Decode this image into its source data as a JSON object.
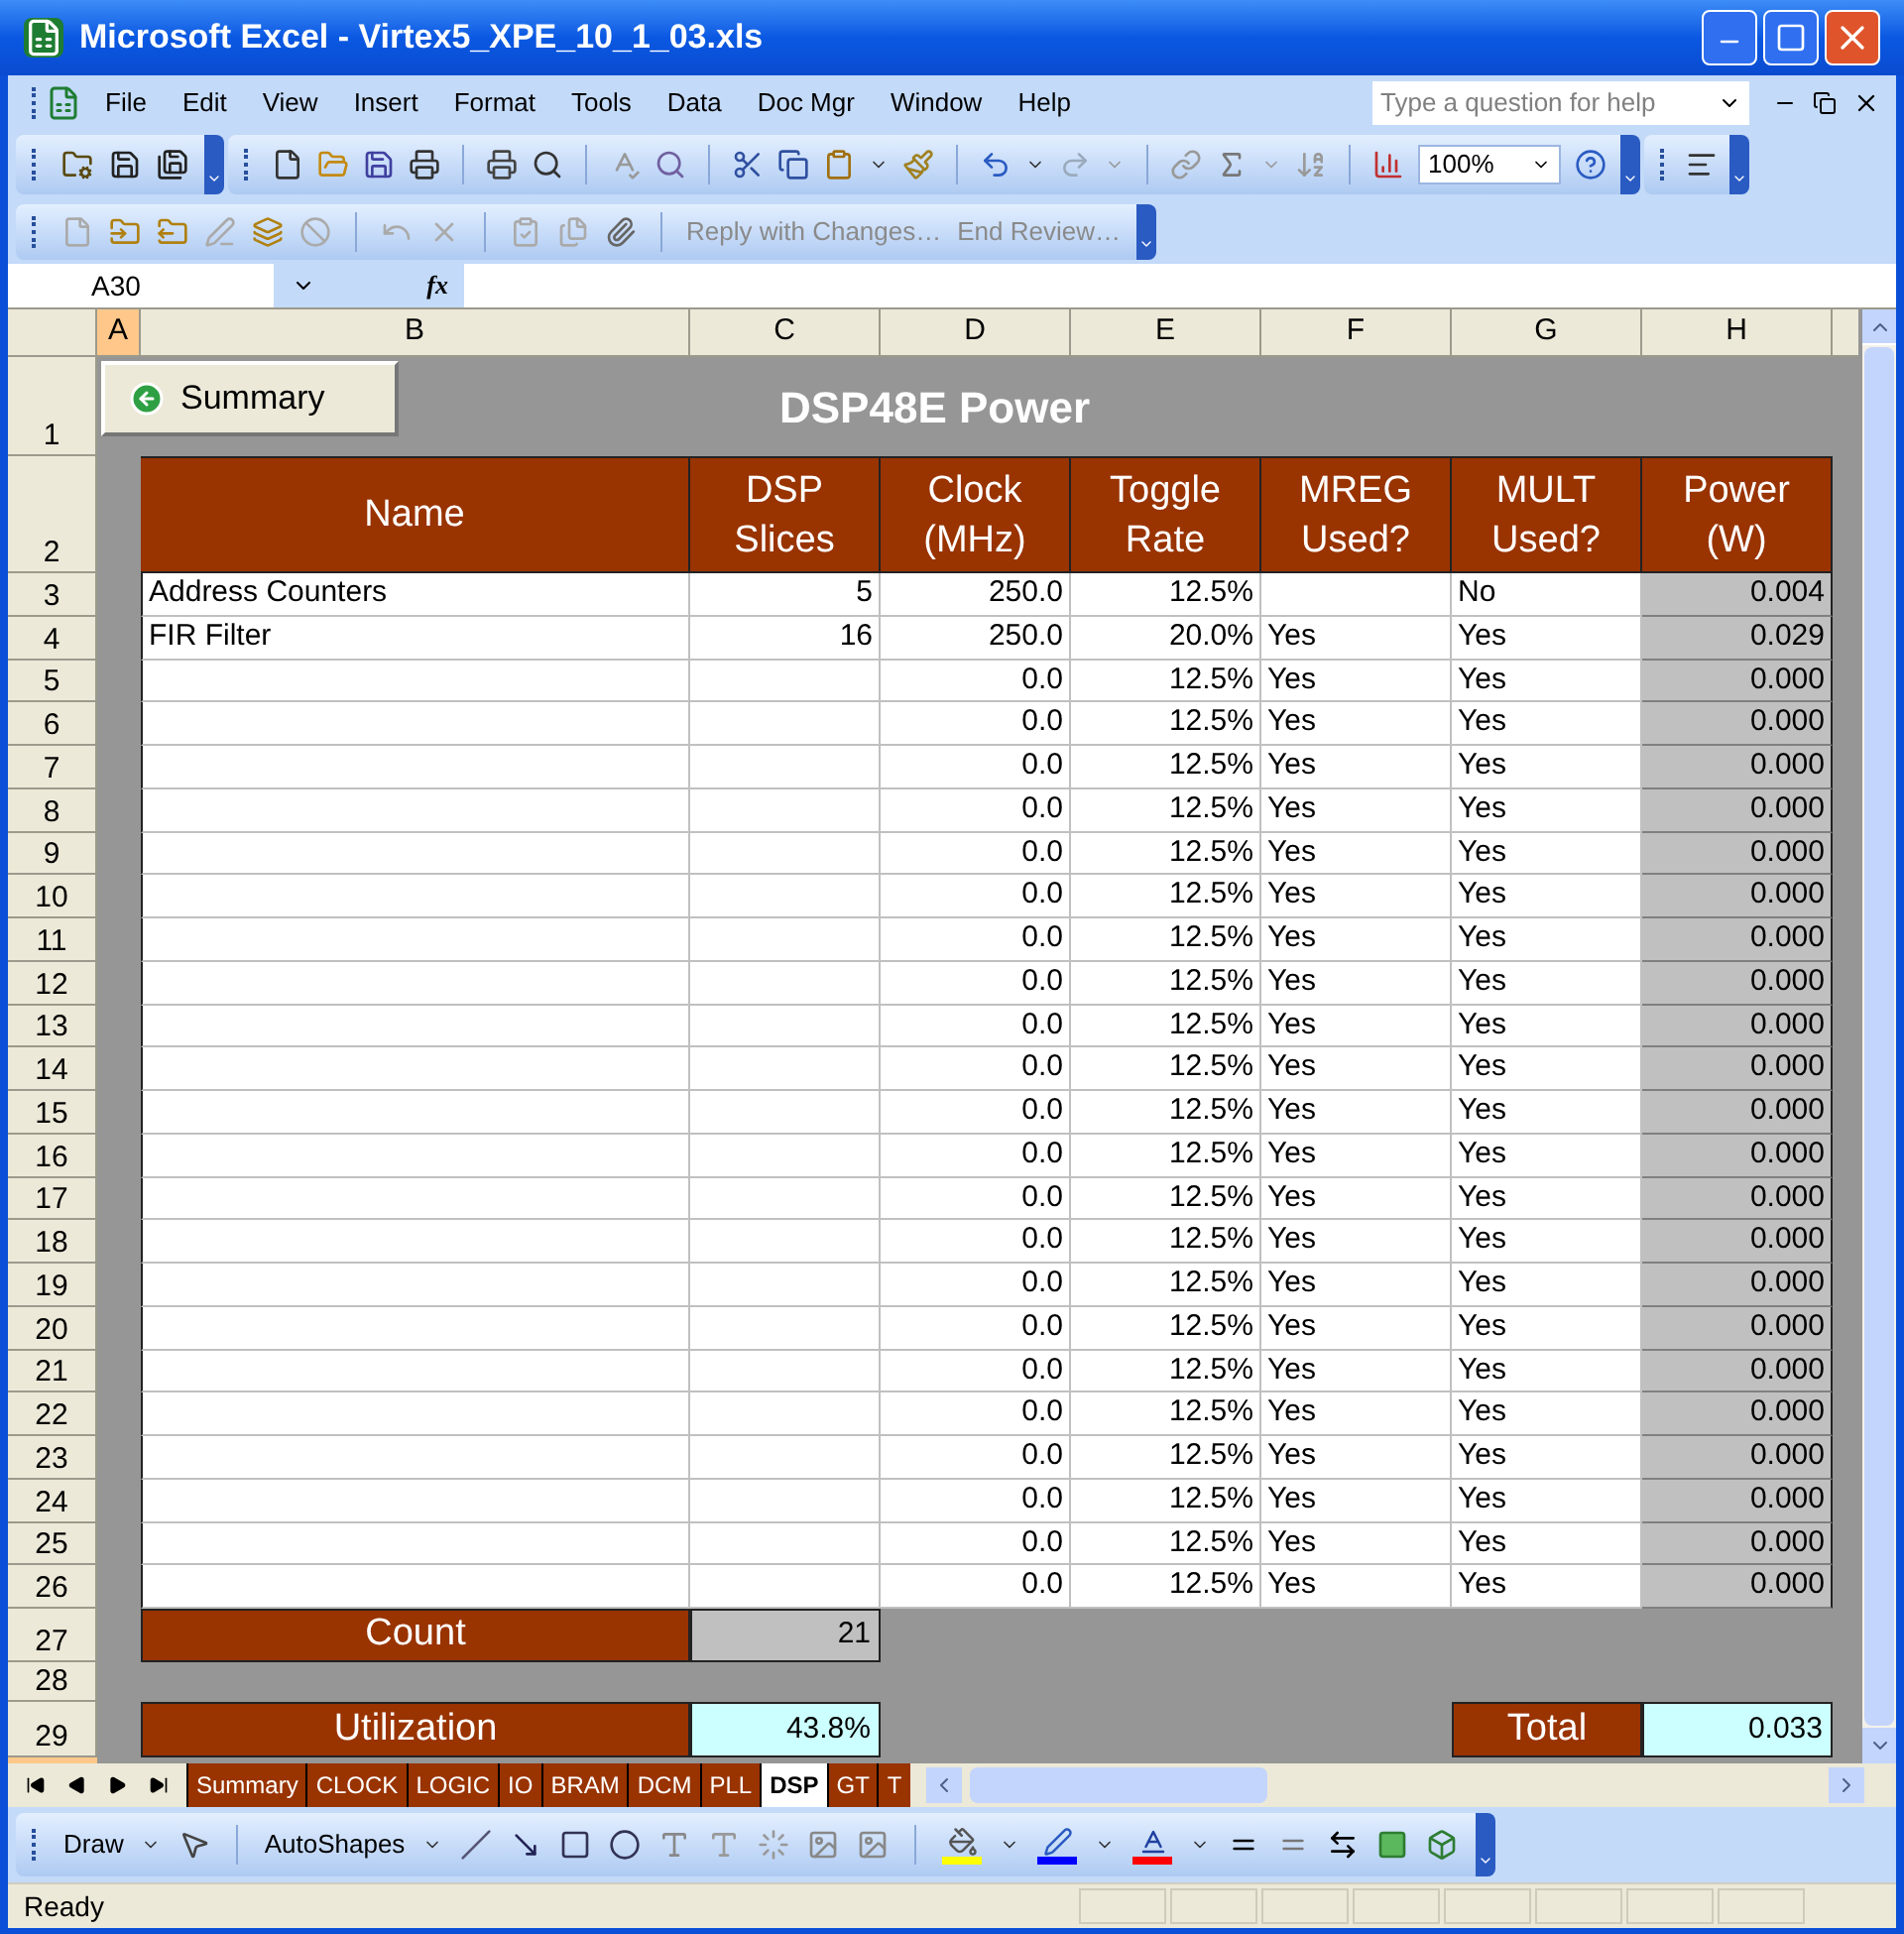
{
  "window": {
    "title": "Microsoft Excel - Virtex5_XPE_10_1_03.xls"
  },
  "menu": [
    "File",
    "Edit",
    "View",
    "Insert",
    "Format",
    "Tools",
    "Data",
    "Doc Mgr",
    "Window",
    "Help"
  ],
  "help_box": {
    "placeholder": "Type a question for help"
  },
  "zoom": "100%",
  "review_toolbar": [
    "Reply with Changes…",
    "End Review…"
  ],
  "formula_bar": {
    "name_box": "A30",
    "function_label": "fx"
  },
  "columns": [
    {
      "label": "A",
      "selected": true
    },
    {
      "label": "B",
      "selected": false
    },
    {
      "label": "C",
      "selected": false
    },
    {
      "label": "D",
      "selected": false
    },
    {
      "label": "E",
      "selected": false
    },
    {
      "label": "F",
      "selected": false
    },
    {
      "label": "G",
      "selected": false
    },
    {
      "label": "H",
      "selected": false
    }
  ],
  "sheet": {
    "row_1": "1",
    "row_2": "2",
    "summary_button": "Summary",
    "title": "DSP48E Power",
    "headers": [
      {
        "lines": [
          "Name"
        ]
      },
      {
        "lines": [
          "DSP",
          "Slices"
        ]
      },
      {
        "lines": [
          "Clock",
          "(MHz)"
        ]
      },
      {
        "lines": [
          "Toggle",
          "Rate"
        ]
      },
      {
        "lines": [
          "MREG",
          "Used?"
        ]
      },
      {
        "lines": [
          "MULT",
          "Used?"
        ]
      },
      {
        "lines": [
          "Power",
          "(W)"
        ]
      }
    ],
    "rows": [
      {
        "row": "3",
        "name": "Address Counters",
        "slices": "5",
        "clock": "250.0",
        "toggle": "12.5%",
        "mult": "No",
        "power": "0.004"
      },
      {
        "row": "4",
        "name": "FIR Filter",
        "slices": "16",
        "clock": "250.0",
        "toggle": "20.0%",
        "mreg": "Yes",
        "mult": "Yes",
        "power": "0.029"
      },
      {
        "row": "5",
        "clock": "0.0",
        "toggle": "12.5%",
        "mreg": "Yes",
        "mult": "Yes",
        "power": "0.000"
      },
      {
        "row": "6",
        "clock": "0.0",
        "toggle": "12.5%",
        "mreg": "Yes",
        "mult": "Yes",
        "power": "0.000"
      },
      {
        "row": "7",
        "clock": "0.0",
        "toggle": "12.5%",
        "mreg": "Yes",
        "mult": "Yes",
        "power": "0.000"
      },
      {
        "row": "8",
        "clock": "0.0",
        "toggle": "12.5%",
        "mreg": "Yes",
        "mult": "Yes",
        "power": "0.000"
      },
      {
        "row": "9",
        "clock": "0.0",
        "toggle": "12.5%",
        "mreg": "Yes",
        "mult": "Yes",
        "power": "0.000"
      },
      {
        "row": "10",
        "clock": "0.0",
        "toggle": "12.5%",
        "mreg": "Yes",
        "mult": "Yes",
        "power": "0.000"
      },
      {
        "row": "11",
        "clock": "0.0",
        "toggle": "12.5%",
        "mreg": "Yes",
        "mult": "Yes",
        "power": "0.000"
      },
      {
        "row": "12",
        "clock": "0.0",
        "toggle": "12.5%",
        "mreg": "Yes",
        "mult": "Yes",
        "power": "0.000"
      },
      {
        "row": "13",
        "clock": "0.0",
        "toggle": "12.5%",
        "mreg": "Yes",
        "mult": "Yes",
        "power": "0.000"
      },
      {
        "row": "14",
        "clock": "0.0",
        "toggle": "12.5%",
        "mreg": "Yes",
        "mult": "Yes",
        "power": "0.000"
      },
      {
        "row": "15",
        "clock": "0.0",
        "toggle": "12.5%",
        "mreg": "Yes",
        "mult": "Yes",
        "power": "0.000"
      },
      {
        "row": "16",
        "clock": "0.0",
        "toggle": "12.5%",
        "mreg": "Yes",
        "mult": "Yes",
        "power": "0.000"
      },
      {
        "row": "17",
        "clock": "0.0",
        "toggle": "12.5%",
        "mreg": "Yes",
        "mult": "Yes",
        "power": "0.000"
      },
      {
        "row": "18",
        "clock": "0.0",
        "toggle": "12.5%",
        "mreg": "Yes",
        "mult": "Yes",
        "power": "0.000"
      },
      {
        "row": "19",
        "clock": "0.0",
        "toggle": "12.5%",
        "mreg": "Yes",
        "mult": "Yes",
        "power": "0.000"
      },
      {
        "row": "20",
        "clock": "0.0",
        "toggle": "12.5%",
        "mreg": "Yes",
        "mult": "Yes",
        "power": "0.000"
      },
      {
        "row": "21",
        "clock": "0.0",
        "toggle": "12.5%",
        "mreg": "Yes",
        "mult": "Yes",
        "power": "0.000"
      },
      {
        "row": "22",
        "clock": "0.0",
        "toggle": "12.5%",
        "mreg": "Yes",
        "mult": "Yes",
        "power": "0.000"
      },
      {
        "row": "23",
        "clock": "0.0",
        "toggle": "12.5%",
        "mreg": "Yes",
        "mult": "Yes",
        "power": "0.000"
      },
      {
        "row": "24",
        "clock": "0.0",
        "toggle": "12.5%",
        "mreg": "Yes",
        "mult": "Yes",
        "power": "0.000"
      },
      {
        "row": "25",
        "clock": "0.0",
        "toggle": "12.5%",
        "mreg": "Yes",
        "mult": "Yes",
        "power": "0.000"
      },
      {
        "row": "26",
        "clock": "0.0",
        "toggle": "12.5%",
        "mreg": "Yes",
        "mult": "Yes",
        "power": "0.000"
      }
    ],
    "count": {
      "row": "27",
      "label": "Count",
      "value": "21"
    },
    "row_28": "28",
    "utilization": {
      "row": "29",
      "label": "Utilization",
      "value": "43.8%"
    },
    "total": {
      "label": "Total",
      "value": "0.033"
    },
    "row_30": {
      "selected": true
    }
  },
  "sheet_tabs": [
    {
      "label": "Summary",
      "selected": false
    },
    {
      "label": "CLOCK",
      "selected": false
    },
    {
      "label": "LOGIC",
      "selected": false
    },
    {
      "label": "IO",
      "selected": false
    },
    {
      "label": "BRAM",
      "selected": false
    },
    {
      "label": "DCM",
      "selected": false
    },
    {
      "label": "PLL",
      "selected": false
    },
    {
      "label": "DSP",
      "selected": true
    },
    {
      "label": "GT",
      "selected": false
    },
    {
      "label": "T",
      "selected": false
    }
  ],
  "draw_toolbar": {
    "draw": "Draw",
    "autoshapes": "AutoShapes"
  },
  "status_bar": {
    "text": "Ready"
  }
}
